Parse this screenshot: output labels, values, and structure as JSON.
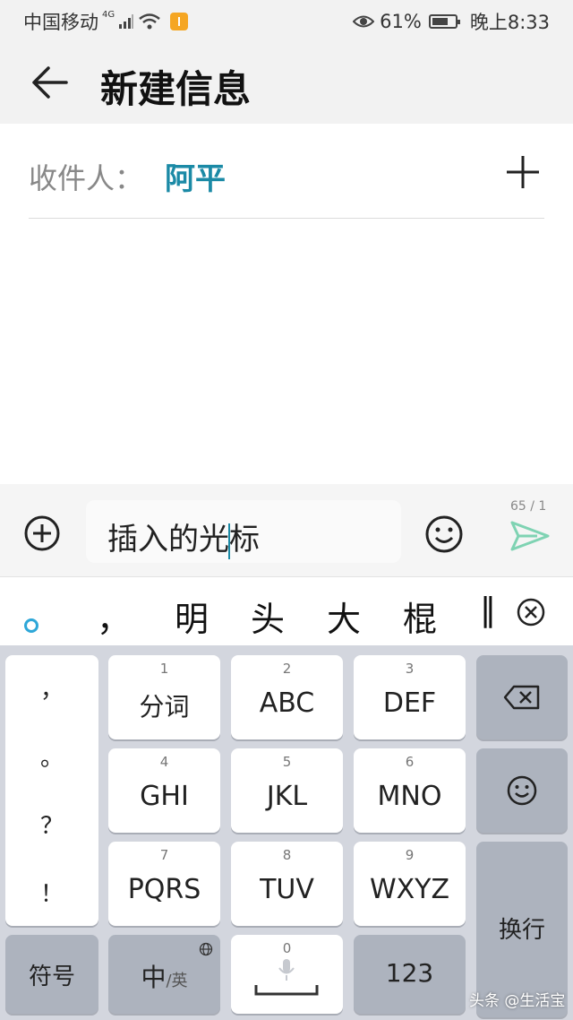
{
  "status_bar": {
    "carrier": "中国移动",
    "network": "4G",
    "battery": "61%",
    "time": "晚上8:33"
  },
  "header": {
    "title": "新建信息"
  },
  "recipient": {
    "label": "收件人：",
    "name": "阿平"
  },
  "compose": {
    "text_before_cursor": "插入的光",
    "text_after_cursor": "标",
    "counter": "65 / 1"
  },
  "candidates": {
    "items": [
      "，",
      "明",
      "头",
      "大",
      "棍"
    ],
    "more": "‖"
  },
  "keyboard": {
    "punctuation": [
      "，",
      "。",
      "？",
      "！"
    ],
    "keys": [
      {
        "num": "1",
        "label": "分词"
      },
      {
        "num": "2",
        "label": "ABC"
      },
      {
        "num": "3",
        "label": "DEF"
      },
      {
        "num": "4",
        "label": "GHI"
      },
      {
        "num": "5",
        "label": "JKL"
      },
      {
        "num": "6",
        "label": "MNO"
      },
      {
        "num": "7",
        "label": "PQRS"
      },
      {
        "num": "8",
        "label": "TUV"
      },
      {
        "num": "9",
        "label": "WXYZ"
      }
    ],
    "symbols_label": "符号",
    "lang_main": "中",
    "lang_sub": "/英",
    "space_num": "0",
    "numbers_label": "123",
    "enter_label": "换行"
  },
  "watermark": "头条 @生活宝",
  "colors": {
    "accent": "#1b8aa6",
    "send": "#7fd3b3",
    "keyboard_bg": "#d3d6de"
  }
}
